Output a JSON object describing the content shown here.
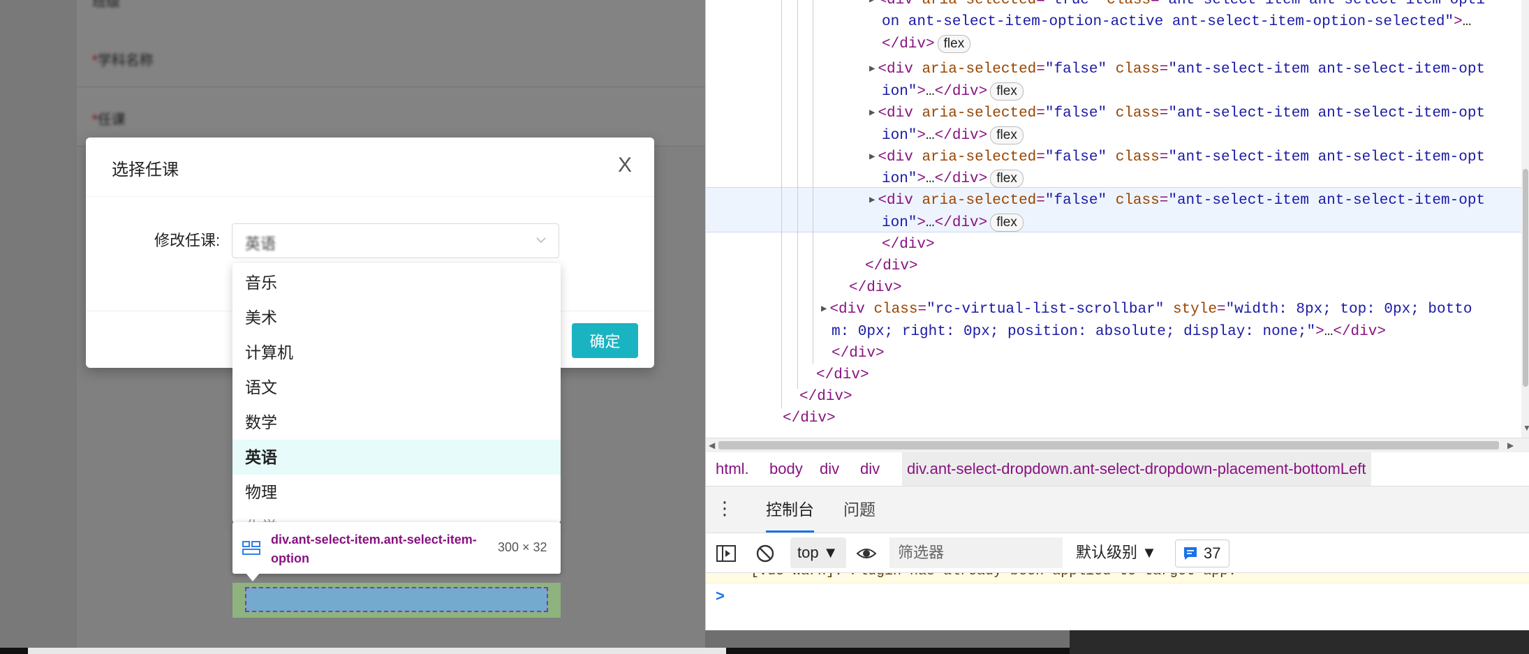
{
  "app": {
    "rows": [
      {
        "label": "班级"
      },
      {
        "label": "学科名称",
        "required": "*"
      },
      {
        "label": "任课",
        "required": "*"
      }
    ]
  },
  "modal": {
    "title": "选择任课",
    "close_label": "X",
    "form_label": "修改任课:",
    "select_value": "英语",
    "ok_label": "确定"
  },
  "dropdown": {
    "options": [
      {
        "label": "音乐",
        "selected": false
      },
      {
        "label": "美术",
        "selected": false
      },
      {
        "label": "计算机",
        "selected": false
      },
      {
        "label": "语文",
        "selected": false
      },
      {
        "label": "数学",
        "selected": false
      },
      {
        "label": "英语",
        "selected": true
      },
      {
        "label": "物理",
        "selected": false
      },
      {
        "label": "化学",
        "selected": false
      }
    ]
  },
  "inspector_tooltip": {
    "selector": "div.ant-select-item.ant-select-item-option",
    "size": "300 × 32",
    "icon": "flex-layout-icon"
  },
  "devtools": {
    "elements": {
      "lines": [
        {
          "parts": [
            [
              "tag",
              "<div "
            ],
            [
              "attr",
              "aria-selected"
            ],
            [
              "tag",
              "="
            ],
            [
              "val",
              "\"true\""
            ],
            [
              "tag",
              " "
            ],
            [
              "attr",
              "class"
            ],
            [
              "tag",
              "="
            ],
            [
              "val",
              "\"ant-select-item ant-select-item-opti"
            ]
          ]
        },
        {
          "parts": [
            [
              "val",
              "on ant-select-item-option-active ant-select-item-option-selected\""
            ],
            [
              "tag",
              ">"
            ],
            [
              "plain",
              "…"
            ]
          ]
        },
        {
          "parts": [
            [
              "tag",
              "</div>"
            ]
          ],
          "pill": "flex"
        },
        {
          "parts": [
            [
              "tag",
              "<div "
            ],
            [
              "attr",
              "aria-selected"
            ],
            [
              "tag",
              "="
            ],
            [
              "val",
              "\"false\""
            ],
            [
              "tag",
              " "
            ],
            [
              "attr",
              "class"
            ],
            [
              "tag",
              "="
            ],
            [
              "val",
              "\"ant-select-item ant-select-item-opt"
            ]
          ]
        },
        {
          "parts": [
            [
              "val",
              "ion\""
            ],
            [
              "tag",
              ">"
            ],
            [
              "plain",
              "…"
            ],
            [
              "tag",
              "</div>"
            ]
          ],
          "pill": "flex"
        },
        {
          "parts": [
            [
              "tag",
              "<div "
            ],
            [
              "attr",
              "aria-selected"
            ],
            [
              "tag",
              "="
            ],
            [
              "val",
              "\"false\""
            ],
            [
              "tag",
              " "
            ],
            [
              "attr",
              "class"
            ],
            [
              "tag",
              "="
            ],
            [
              "val",
              "\"ant-select-item ant-select-item-opt"
            ]
          ]
        },
        {
          "parts": [
            [
              "val",
              "ion\""
            ],
            [
              "tag",
              ">"
            ],
            [
              "plain",
              "…"
            ],
            [
              "tag",
              "</div>"
            ]
          ],
          "pill": "flex"
        },
        {
          "parts": [
            [
              "tag",
              "<div "
            ],
            [
              "attr",
              "aria-selected"
            ],
            [
              "tag",
              "="
            ],
            [
              "val",
              "\"false\""
            ],
            [
              "tag",
              " "
            ],
            [
              "attr",
              "class"
            ],
            [
              "tag",
              "="
            ],
            [
              "val",
              "\"ant-select-item ant-select-item-opt"
            ]
          ]
        },
        {
          "parts": [
            [
              "val",
              "ion\""
            ],
            [
              "tag",
              ">"
            ],
            [
              "plain",
              "…"
            ],
            [
              "tag",
              "</div>"
            ]
          ],
          "pill": "flex"
        },
        {
          "parts": [
            [
              "tag",
              "<div "
            ],
            [
              "attr",
              "aria-selected"
            ],
            [
              "tag",
              "="
            ],
            [
              "val",
              "\"false\""
            ],
            [
              "tag",
              " "
            ],
            [
              "attr",
              "class"
            ],
            [
              "tag",
              "="
            ],
            [
              "val",
              "\"ant-select-item ant-select-item-opt"
            ]
          ]
        },
        {
          "parts": [
            [
              "val",
              "ion\""
            ],
            [
              "tag",
              ">"
            ],
            [
              "plain",
              "…"
            ],
            [
              "tag",
              "</div>"
            ]
          ],
          "pill": "flex"
        },
        {
          "parts": [
            [
              "tag",
              "</div>"
            ]
          ]
        },
        {
          "parts": [
            [
              "tag",
              "</div>"
            ]
          ]
        },
        {
          "parts": [
            [
              "tag",
              "</div>"
            ]
          ]
        },
        {
          "parts": [
            [
              "tag",
              "<div "
            ],
            [
              "attr",
              "class"
            ],
            [
              "tag",
              "="
            ],
            [
              "val",
              "\"rc-virtual-list-scrollbar\""
            ],
            [
              "tag",
              " "
            ],
            [
              "attr",
              "style"
            ],
            [
              "tag",
              "="
            ],
            [
              "val",
              "\"width: 8px; top: 0px; botto"
            ]
          ]
        },
        {
          "parts": [
            [
              "val",
              "m: 0px; right: 0px; position: absolute; display: none;\""
            ],
            [
              "tag",
              ">"
            ],
            [
              "plain",
              "…"
            ],
            [
              "tag",
              "</div>"
            ]
          ]
        },
        {
          "parts": [
            [
              "tag",
              "</div>"
            ]
          ]
        },
        {
          "parts": [
            [
              "tag",
              "</div>"
            ]
          ]
        },
        {
          "parts": [
            [
              "tag",
              "</div>"
            ]
          ]
        },
        {
          "parts": [
            [
              "tag",
              "</div>"
            ]
          ]
        }
      ]
    },
    "breadcrumbs": [
      {
        "label": "html."
      },
      {
        "label": "body"
      },
      {
        "label": "div"
      },
      {
        "label": "div"
      },
      {
        "label": "div.ant-select-dropdown.ant-select-dropdown-placement-bottomLeft",
        "active": true
      }
    ],
    "drawer": {
      "more_label": "⋮",
      "tabs": [
        {
          "label": "控制台",
          "active": true
        },
        {
          "label": "问题",
          "active": false
        }
      ]
    },
    "console": {
      "context": "top ▼",
      "filter_placeholder": "筛选器",
      "level": "默认级别 ▼",
      "issues_count": "37",
      "warning_text": "[Vue warn]: Plugin has already been applied to target app.",
      "prompt": ">"
    }
  },
  "colors": {
    "accent": "#1ab3c2",
    "selected_option_bg": "#e6fbfa",
    "devtools_tag": "#881280",
    "devtools_attr": "#994500",
    "devtools_value": "#1a1aa6"
  }
}
